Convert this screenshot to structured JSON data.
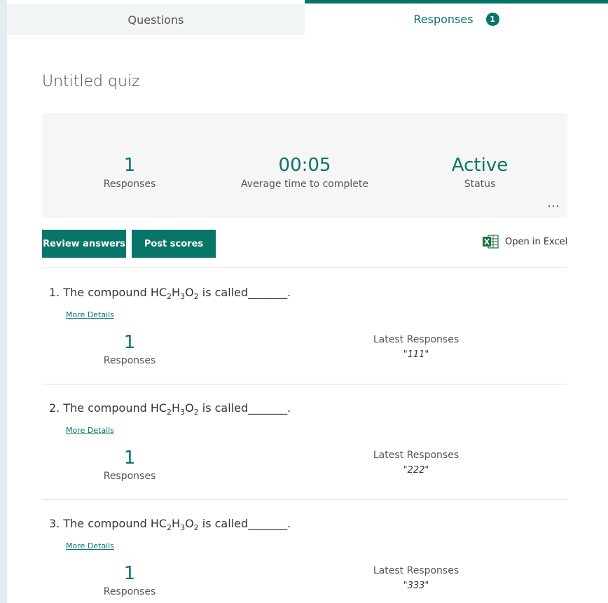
{
  "tabs": {
    "questions": "Questions",
    "responses": "Responses",
    "responses_badge": "1"
  },
  "quiz": {
    "title": "Untitled quiz"
  },
  "stats": {
    "responses_value": "1",
    "responses_label": "Responses",
    "avg_time_value": "00:05",
    "avg_time_label": "Average time to complete",
    "status_value": "Active",
    "status_label": "Status",
    "more_icon": "ellipsis-icon"
  },
  "actions": {
    "review_answers": "Review answers",
    "post_scores": "Post scores",
    "open_in_excel": "Open in Excel",
    "excel_icon": "excel-icon"
  },
  "questions": [
    {
      "number": "1.",
      "text_prefix": "The compound HC",
      "sub1": "2",
      "mid1": "H",
      "sub2": "3",
      "mid2": "O",
      "sub3": "2",
      "text_suffix": " is called_______.",
      "more_details": "More Details",
      "count_value": "1",
      "count_label": "Responses",
      "latest_label": "Latest Responses",
      "latest_value": "\"111\""
    },
    {
      "number": "2.",
      "text_prefix": "The compound HC",
      "sub1": "2",
      "mid1": "H",
      "sub2": "3",
      "mid2": "O",
      "sub3": "2",
      "text_suffix": " is called_______.",
      "more_details": "More Details",
      "count_value": "1",
      "count_label": "Responses",
      "latest_label": "Latest Responses",
      "latest_value": "\"222\""
    },
    {
      "number": "3.",
      "text_prefix": "The compound HC",
      "sub1": "2",
      "mid1": "H",
      "sub2": "3",
      "mid2": "O",
      "sub3": "2",
      "text_suffix": " is called_______.",
      "more_details": "More Details",
      "count_value": "1",
      "count_label": "Responses",
      "latest_label": "Latest Responses",
      "latest_value": "\"333\""
    }
  ],
  "colors": {
    "accent": "#077568",
    "panel": "#f6f6f6",
    "excel_green": "#1e7145"
  }
}
